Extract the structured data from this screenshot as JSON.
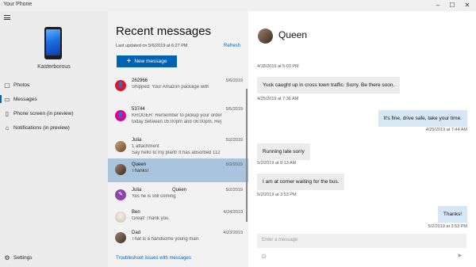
{
  "app": {
    "title": "Your Phone"
  },
  "window_controls": {
    "minimize": "–",
    "maximize": "☐",
    "close": "✕"
  },
  "sidebar": {
    "device_name": "Kasterborous",
    "items": [
      {
        "label": "Photos",
        "icon": "photo-icon",
        "glyph": "▢"
      },
      {
        "label": "Messages",
        "icon": "message-icon",
        "glyph": "▭"
      },
      {
        "label": "Phone screen (in preview)",
        "icon": "phone-screen-icon",
        "glyph": "▯"
      },
      {
        "label": "Notifications (in preview)",
        "icon": "bell-icon",
        "glyph": "⌂"
      }
    ],
    "settings_label": "Settings",
    "settings_glyph": "⚙"
  },
  "messages_list": {
    "title": "Recent messages",
    "last_updated": "Last updated on 5/6/2019 at 6:27 PM",
    "refresh_label": "Refresh",
    "new_message_label": "New message",
    "new_message_glyph": "+",
    "conversations": [
      {
        "name": "262966",
        "date": "5/6/2019",
        "preview": "Shipped: Your Amazon package with",
        "avatar_color": "#e81123",
        "avatar_glyph": "👤"
      },
      {
        "name": "53744",
        "date": "5/5/2019",
        "preview": "KROGER: Remember to pickup your order",
        "preview2": "today between 05:00pm and 06:00pm. Rej",
        "avatar_color": "#e3008c",
        "avatar_glyph": "👤"
      },
      {
        "name": "Julia",
        "date": "5/2/2019",
        "preview": "1 attachment",
        "preview2": "Say hello to my plant! It has absorbed 112",
        "avatar_color": "#8a6a4a"
      },
      {
        "name": "Queen",
        "date": "5/2/2019",
        "preview": "Thanks!",
        "avatar_color": "#5a4a40",
        "selected": true
      },
      {
        "name": "Julia",
        "name2": "Queen",
        "date": "5/2/2019",
        "preview": "Yes he is still coming",
        "avatar_color": "#8e44ad",
        "avatar_glyph": "✎"
      },
      {
        "name": "Ben",
        "date": "4/24/2019",
        "preview": "Great! Thank you.",
        "avatar_color": "#d6cfc4"
      },
      {
        "name": "Dad",
        "date": "4/23/2019",
        "preview": "That is a handsome young man",
        "avatar_color": "#6a5a4a"
      }
    ],
    "troubleshoot_label": "Troubleshoot issues with messages"
  },
  "conversation": {
    "contact_name": "Queen",
    "messages": [
      {
        "timestamp": "4/18/2019 at 5:03 PM"
      },
      {
        "text": "Yuck caught up in cross town traffic. Sorry. Be there soon.",
        "direction": "in",
        "timestamp": "4/25/2019 at 7:36 AM"
      },
      {
        "text": "It's fine, drive safe, take your time.",
        "direction": "out",
        "timestamp": "4/25/2019 at 7:44 AM"
      },
      {
        "text": "Running late sorry",
        "direction": "in",
        "timestamp": "5/2/2019 at 8:13 AM"
      },
      {
        "text": "I am at corner waiting for the bus.",
        "direction": "in",
        "timestamp": "5/2/2019 at 3:53 PM"
      },
      {
        "text": "Thanks!",
        "direction": "out",
        "timestamp": "5/2/2019 at 3:53 PM"
      }
    ],
    "compose_placeholder": "Enter a message",
    "emoji_glyph": "☺",
    "send_glyph": "➤"
  },
  "colors": {
    "accent": "#0063b1",
    "selected_row": "#a9c4dd",
    "outgoing_bubble": "#d8e7f5",
    "incoming_bubble": "#ececec"
  }
}
